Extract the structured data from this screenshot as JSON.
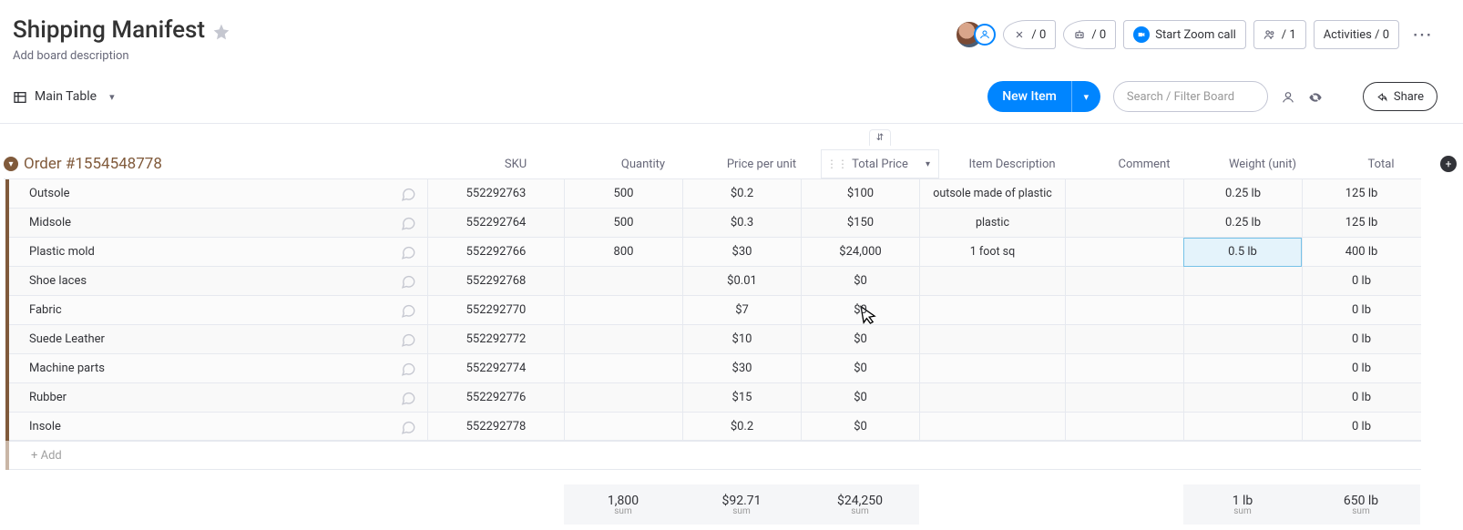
{
  "header": {
    "title": "Shipping Manifest",
    "desc_prompt": "Add board description",
    "integrations_count": "/ 0",
    "automations_count": "/ 0",
    "zoom_label": "Start Zoom call",
    "people_count": "/ 1",
    "activities_label": "Activities / 0"
  },
  "subheader": {
    "view_name": "Main Table",
    "new_item": "New Item",
    "search_placeholder": "Search / Filter Board",
    "share": "Share"
  },
  "group": {
    "title": "Order #1554548778",
    "accent": "#805a3b"
  },
  "columns": {
    "sku": "SKU",
    "qty": "Quantity",
    "ppu": "Price per unit",
    "total": "Total Price",
    "desc": "Item Description",
    "comment": "Comment",
    "wt": "Weight (unit)",
    "tot": "Total"
  },
  "rows": [
    {
      "name": "Outsole",
      "sku": "552292763",
      "qty": "500",
      "ppu": "$0.2",
      "total": "$100",
      "desc": "outsole made of plastic",
      "comment": "",
      "wt": "0.25 lb",
      "tot": "125 lb"
    },
    {
      "name": "Midsole",
      "sku": "552292764",
      "qty": "500",
      "ppu": "$0.3",
      "total": "$150",
      "desc": "plastic",
      "comment": "",
      "wt": "0.25 lb",
      "tot": "125 lb"
    },
    {
      "name": "Plastic mold",
      "sku": "552292766",
      "qty": "800",
      "ppu": "$30",
      "total": "$24,000",
      "desc": "1 foot sq",
      "comment": "",
      "wt": "0.5 lb",
      "tot": "400 lb",
      "highlight_wt": true
    },
    {
      "name": "Shoe laces",
      "sku": "552292768",
      "qty": "",
      "ppu": "$0.01",
      "total": "$0",
      "desc": "",
      "comment": "",
      "wt": "",
      "tot": "0 lb"
    },
    {
      "name": "Fabric",
      "sku": "552292770",
      "qty": "",
      "ppu": "$7",
      "total": "$0",
      "desc": "",
      "comment": "",
      "wt": "",
      "tot": "0 lb"
    },
    {
      "name": "Suede Leather",
      "sku": "552292772",
      "qty": "",
      "ppu": "$10",
      "total": "$0",
      "desc": "",
      "comment": "",
      "wt": "",
      "tot": "0 lb"
    },
    {
      "name": "Machine parts",
      "sku": "552292774",
      "qty": "",
      "ppu": "$30",
      "total": "$0",
      "desc": "",
      "comment": "",
      "wt": "",
      "tot": "0 lb"
    },
    {
      "name": "Rubber",
      "sku": "552292776",
      "qty": "",
      "ppu": "$15",
      "total": "$0",
      "desc": "",
      "comment": "",
      "wt": "",
      "tot": "0 lb"
    },
    {
      "name": "Insole",
      "sku": "552292778",
      "qty": "",
      "ppu": "$0.2",
      "total": "$0",
      "desc": "",
      "comment": "",
      "wt": "",
      "tot": "0 lb"
    }
  ],
  "add_row": "+ Add",
  "sums": {
    "qty": {
      "value": "1,800",
      "label": "sum"
    },
    "ppu": {
      "value": "$92.71",
      "label": "sum"
    },
    "total": {
      "value": "$24,250",
      "label": "sum"
    },
    "wt": {
      "value": "1 lb",
      "label": "sum"
    },
    "tot": {
      "value": "650 lb",
      "label": "sum"
    }
  }
}
